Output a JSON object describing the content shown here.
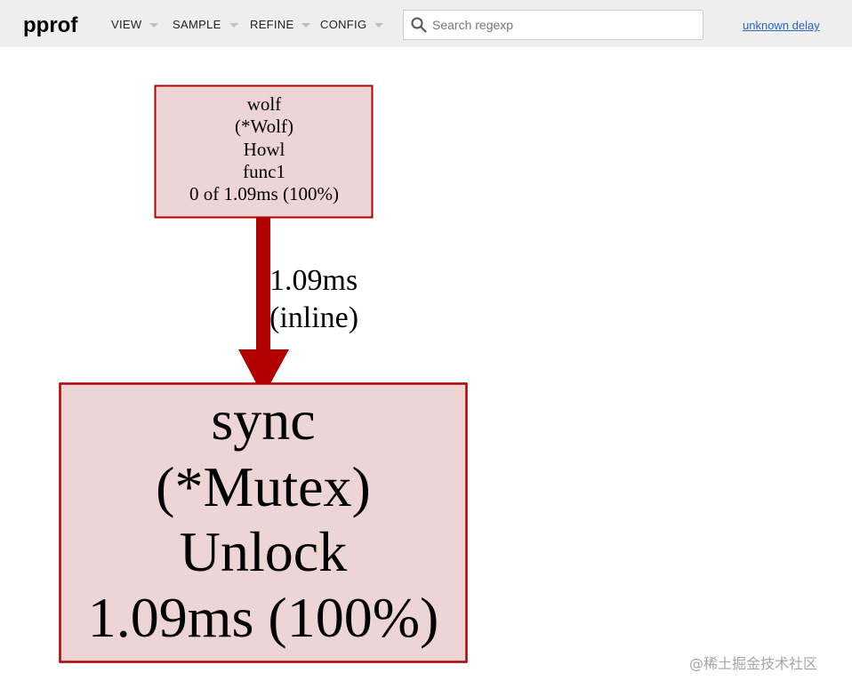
{
  "app": {
    "title": "pprof"
  },
  "menus": [
    {
      "label": "VIEW"
    },
    {
      "label": "SAMPLE"
    },
    {
      "label": "REFINE"
    },
    {
      "label": "CONFIG"
    }
  ],
  "search": {
    "placeholder": "Search regexp",
    "value": ""
  },
  "delay_link": "unknown delay",
  "graph": {
    "colors": {
      "node_fill": "#edd5d5",
      "node_border": "#b20000",
      "edge": "#b20000"
    },
    "nodes": [
      {
        "id": "wolf-func1",
        "lines": [
          "wolf",
          "(*Wolf)",
          "Howl",
          "func1",
          "0 of 1.09ms (100%)"
        ]
      },
      {
        "id": "sync-unlock",
        "lines": [
          "sync",
          "(*Mutex)",
          "Unlock",
          "1.09ms (100%)"
        ]
      }
    ],
    "edges": [
      {
        "from": "wolf-func1",
        "to": "sync-unlock",
        "lines": [
          "1.09ms",
          "(inline)"
        ]
      }
    ]
  },
  "watermark": "@稀土掘金技术社区"
}
